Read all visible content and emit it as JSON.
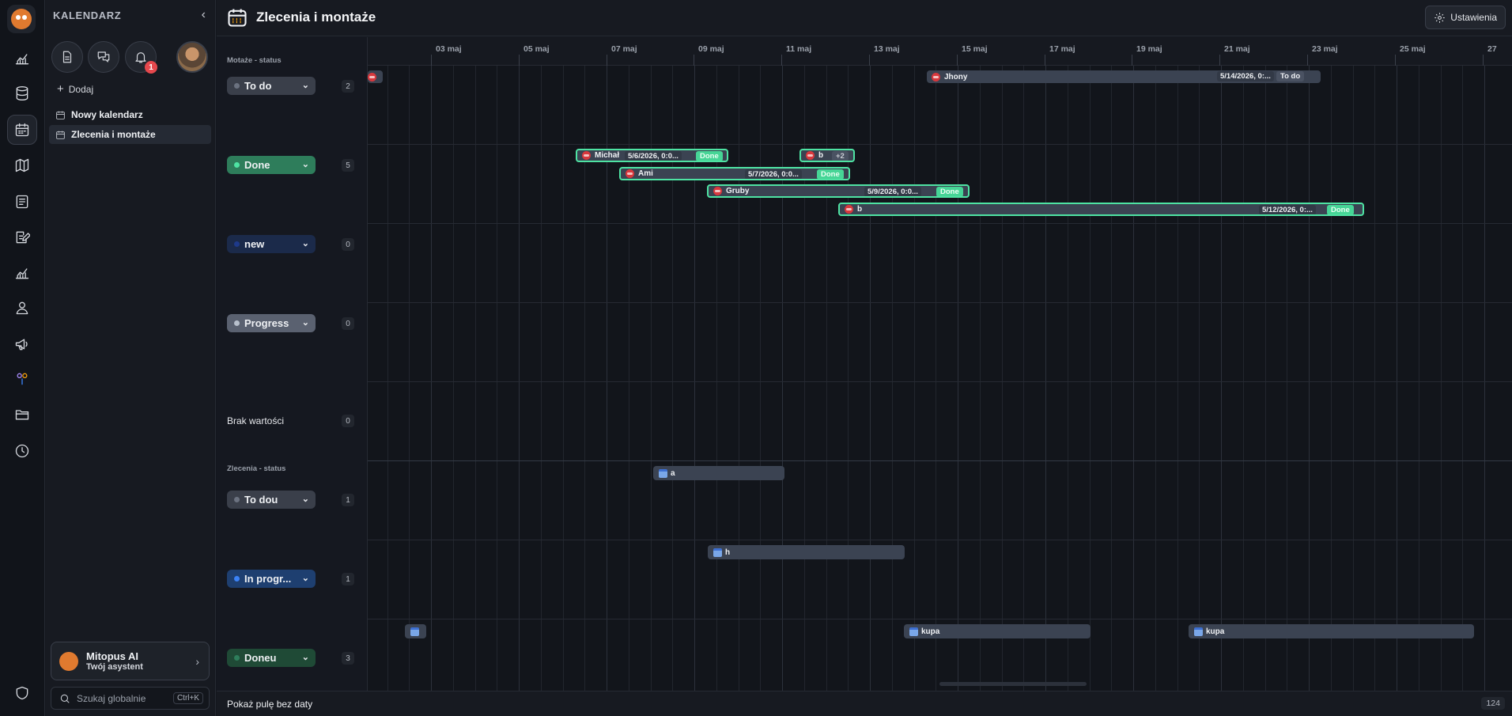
{
  "sidebar": {
    "title": "KALENDARZ",
    "collapse_icon": "‹",
    "add_label": "Dodaj",
    "notification_count": "1",
    "calendars": [
      {
        "label": "Nowy kalendarz",
        "active": false
      },
      {
        "label": "Zlecenia i montaże",
        "active": true
      }
    ],
    "ai": {
      "title": "Mitopus AI",
      "subtitle": "Twój asystent"
    },
    "search": {
      "placeholder": "Szukaj globalnie",
      "shortcut": "Ctrl+K"
    }
  },
  "rail_icons": [
    "logo-icon",
    "chart-icon",
    "database-icon",
    "calendar-icon",
    "map-icon",
    "list-icon",
    "edit-icon",
    "analytics-icon",
    "user-icon",
    "megaphone-icon",
    "integration-icon",
    "folder-icon",
    "clock-icon",
    "shield-icon"
  ],
  "header": {
    "title": "Zlecenia i montaże",
    "settings_label": "Ustawienia"
  },
  "dates": [
    "03 maj",
    "05 maj",
    "07 maj",
    "09 maj",
    "11 maj",
    "13 maj",
    "15 maj",
    "17 maj",
    "19 maj",
    "21 maj",
    "23 maj",
    "25 maj",
    "27"
  ],
  "groups": [
    {
      "title": "Motaże - status",
      "rows": [
        {
          "label": "To do",
          "count": "2",
          "color": "#3a3f4a",
          "dot": "#6b7280"
        },
        {
          "label": "Done",
          "count": "5",
          "color": "#2e7d5b",
          "dot": "#4ee3a3"
        },
        {
          "label": "new",
          "count": "0",
          "color": "#1b2a4a",
          "dot": "#1e3a8a"
        },
        {
          "label": "Progress",
          "count": "0",
          "color": "#5a6170",
          "dot": "#b8c0cc"
        },
        {
          "label": "Brak wartości",
          "count": "0",
          "color": "",
          "dot": ""
        }
      ]
    },
    {
      "title": "Zlecenia - status",
      "rows": [
        {
          "label": "To dou",
          "count": "1",
          "color": "#3a3f4a",
          "dot": "#6b7280"
        },
        {
          "label": "In progr...",
          "count": "1",
          "color": "#1e3f70",
          "dot": "#3b82f6"
        },
        {
          "label": "Doneu",
          "count": "3",
          "color": "#1f4a36",
          "dot": "#2e7d5b"
        }
      ]
    }
  ],
  "events": {
    "todo_partial": {
      "title": ""
    },
    "jhony": {
      "title": "Jhony",
      "date": "5/14/2026, 0:...",
      "status": "To do"
    },
    "michal": {
      "title": "Michał",
      "date": "5/6/2026, 0:0...",
      "status": "Done"
    },
    "b_small": {
      "title": "b",
      "more": "+2"
    },
    "ami": {
      "title": "Ami",
      "date": "5/7/2026, 0:0...",
      "status": "Done"
    },
    "gruby": {
      "title": "Gruby",
      "date": "5/9/2026, 0:0...",
      "status": "Done"
    },
    "b_long": {
      "title": "b",
      "date": "5/12/2026, 0:...",
      "status": "Done"
    },
    "a": {
      "title": "a"
    },
    "h": {
      "title": "h"
    },
    "doneu_empty": {
      "title": ""
    },
    "kupa1": {
      "title": "kupa"
    },
    "kupa2": {
      "title": "kupa"
    }
  },
  "footer": {
    "pool_label": "Pokaż pulę bez daty",
    "total": "124"
  }
}
